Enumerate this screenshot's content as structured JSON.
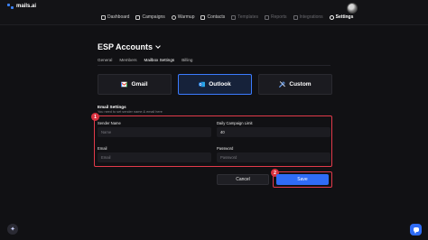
{
  "app": {
    "logo_text": "mails.ai"
  },
  "nav": {
    "items": [
      {
        "label": "Dashboard",
        "icon": "grid-icon",
        "state": "normal"
      },
      {
        "label": "Campaigns",
        "icon": "campaign-icon",
        "state": "normal"
      },
      {
        "label": "Warmup",
        "icon": "warmup-icon",
        "state": "normal"
      },
      {
        "label": "Contacts",
        "icon": "contacts-icon",
        "state": "normal"
      },
      {
        "label": "Templates",
        "icon": "templates-icon",
        "state": "dim"
      },
      {
        "label": "Reports",
        "icon": "reports-icon",
        "state": "dim"
      },
      {
        "label": "Integrations",
        "icon": "integrations-icon",
        "state": "dim"
      },
      {
        "label": "Settings",
        "icon": "gear-icon",
        "state": "active"
      }
    ]
  },
  "page": {
    "title": "ESP Accounts"
  },
  "tabs": [
    "General",
    "Members",
    "Mailbox Settings",
    "Billing"
  ],
  "providers": [
    {
      "label": "Gmail",
      "icon": "gmail-icon",
      "selected": false
    },
    {
      "label": "Outlook",
      "icon": "outlook-icon",
      "selected": true
    },
    {
      "label": "Custom",
      "icon": "tools-icon",
      "selected": false
    }
  ],
  "email_settings": {
    "title": "Email Settings",
    "subtitle": "You need to set sender name & email here",
    "sender_name": {
      "label": "Sender Name",
      "placeholder": "Name",
      "value": ""
    },
    "daily_limit": {
      "label": "Daily Campaign Limit",
      "placeholder": "",
      "value": "40"
    },
    "email": {
      "label": "Email",
      "placeholder": "Email",
      "value": ""
    },
    "password": {
      "label": "Password",
      "placeholder": "Password",
      "value": ""
    }
  },
  "actions": {
    "cancel_label": "Cancel",
    "save_label": "Save"
  },
  "annotations": {
    "badge_1": "1",
    "badge_2": "2"
  },
  "colors": {
    "accent": "#2f6cf6",
    "highlight": "#e23a4a",
    "background": "#111114"
  }
}
